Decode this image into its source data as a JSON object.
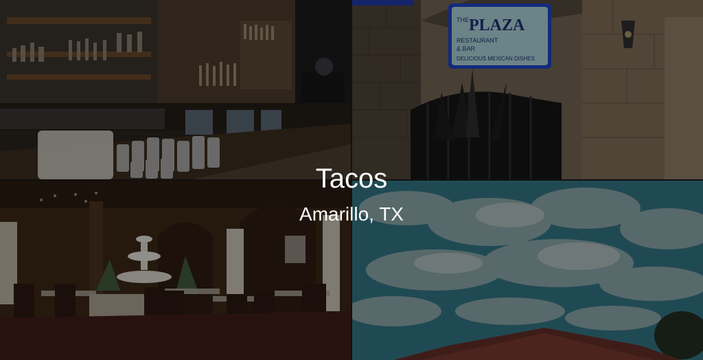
{
  "overlay": {
    "title": "Tacos",
    "subtitle": "Amarillo, TX"
  },
  "tiles": {
    "bar": {
      "scene": "bar-interior"
    },
    "storefront": {
      "scene": "restaurant-storefront",
      "sign": {
        "line1": "THE",
        "line2": "PLAZA",
        "line3": "RESTAURANT",
        "line4": "& BAR",
        "line5": "DELICIOUS MEXICAN DISHES"
      }
    },
    "dining": {
      "scene": "dining-room"
    },
    "sky": {
      "scene": "cloudy-sky-roof"
    }
  },
  "colors": {
    "caption": "#ffffff",
    "sign_bg": "#9ec3c9",
    "sign_border": "#1d3fb8",
    "sign_text": "#1f2d6b"
  }
}
